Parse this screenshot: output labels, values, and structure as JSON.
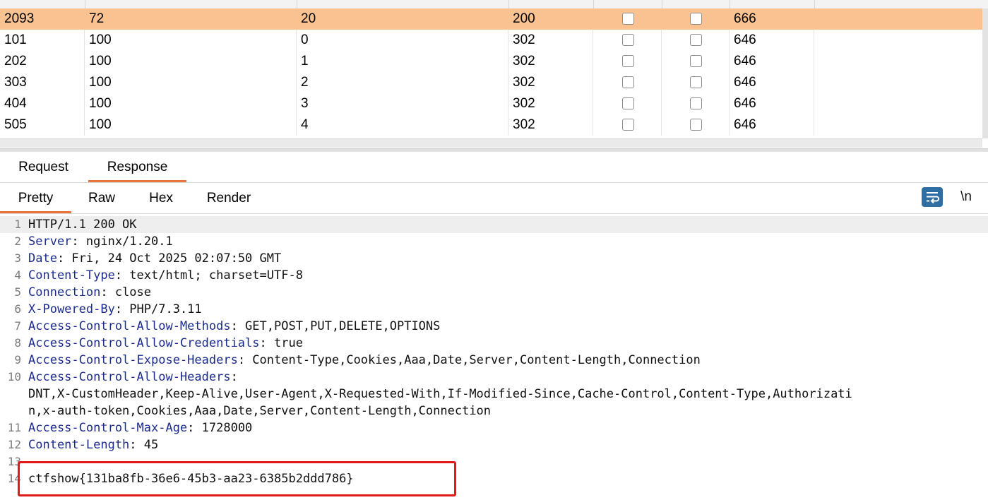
{
  "results": {
    "rows": [
      {
        "c0": "2093",
        "c1": "72",
        "c2": "20",
        "c3": "200",
        "c6": "666",
        "selected": true
      },
      {
        "c0": "101",
        "c1": "100",
        "c2": "0",
        "c3": "302",
        "c6": "646"
      },
      {
        "c0": "202",
        "c1": "100",
        "c2": "1",
        "c3": "302",
        "c6": "646"
      },
      {
        "c0": "303",
        "c1": "100",
        "c2": "2",
        "c3": "302",
        "c6": "646"
      },
      {
        "c0": "404",
        "c1": "100",
        "c2": "3",
        "c3": "302",
        "c6": "646"
      },
      {
        "c0": "505",
        "c1": "100",
        "c2": "4",
        "c3": "302",
        "c6": "646"
      }
    ]
  },
  "tabs": {
    "request": "Request",
    "response": "Response",
    "active": "Response"
  },
  "view_tabs": {
    "pretty": "Pretty",
    "raw": "Raw",
    "hex": "Hex",
    "render": "Render",
    "active": "Pretty"
  },
  "toolbar": {
    "wrap_icon": "wrap-lines-icon",
    "newline_label": "\\n"
  },
  "response": {
    "lines": [
      {
        "n": "1",
        "name": "",
        "text": "HTTP/1.1 200 OK"
      },
      {
        "n": "2",
        "name": "Server",
        "text": ": nginx/1.20.1"
      },
      {
        "n": "3",
        "name": "Date",
        "text": ": Fri, 24 Oct 2025 02:07:50 GMT"
      },
      {
        "n": "4",
        "name": "Content-Type",
        "text": ": text/html; charset=UTF-8"
      },
      {
        "n": "5",
        "name": "Connection",
        "text": ": close"
      },
      {
        "n": "6",
        "name": "X-Powered-By",
        "text": ": PHP/7.3.11"
      },
      {
        "n": "7",
        "name": "Access-Control-Allow-Methods",
        "text": ": GET,POST,PUT,DELETE,OPTIONS"
      },
      {
        "n": "8",
        "name": "Access-Control-Allow-Credentials",
        "text": ": true"
      },
      {
        "n": "9",
        "name": "Access-Control-Expose-Headers",
        "text": ": Content-Type,Cookies,Aaa,Date,Server,Content-Length,Connection"
      },
      {
        "n": "10",
        "name": "Access-Control-Allow-Headers",
        "text": ":"
      },
      {
        "n": "",
        "name": "",
        "text": "DNT,X-CustomHeader,Keep-Alive,User-Agent,X-Requested-With,If-Modified-Since,Cache-Control,Content-Type,Authorizati"
      },
      {
        "n": "",
        "name": "",
        "text": "n,x-auth-token,Cookies,Aaa,Date,Server,Content-Length,Connection"
      },
      {
        "n": "11",
        "name": "Access-Control-Max-Age",
        "text": ": 1728000"
      },
      {
        "n": "12",
        "name": "Content-Length",
        "text": ": 45"
      },
      {
        "n": "13",
        "name": "",
        "text": ""
      },
      {
        "n": "14",
        "name": "",
        "text": "ctfshow{131ba8fb-36e6-45b3-aa23-6385b2ddd786}"
      }
    ]
  },
  "colors": {
    "selected_row": "#f9c290",
    "active_tab_underline": "#e8743b",
    "header_name": "#1c2c8c",
    "highlight_box": "#e0191b"
  }
}
